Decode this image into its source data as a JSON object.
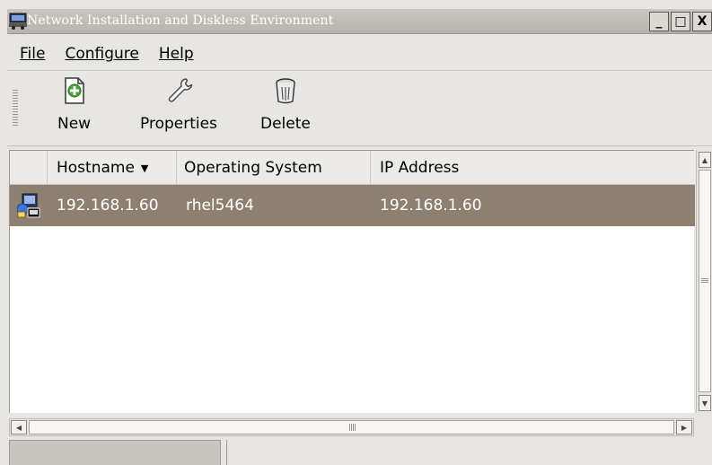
{
  "window": {
    "title": "Network Installation and Diskless Environment",
    "minimize_label": "_",
    "maximize_label": "□",
    "close_label": "X"
  },
  "menu": [
    {
      "label": "File"
    },
    {
      "label": "Configure"
    },
    {
      "label": "Help"
    }
  ],
  "toolbar": {
    "new_label": "New",
    "properties_label": "Properties",
    "delete_label": "Delete"
  },
  "table": {
    "columns": [
      "Hostname",
      "Operating System",
      "IP Address"
    ],
    "sort_indicator": "▼",
    "rows": [
      {
        "hostname": "192.168.1.60",
        "os": "rhel5464",
        "ip": "192.168.1.60"
      }
    ],
    "selected_row_color": "#8d8070"
  },
  "icons": {
    "title": "network-computers-icon",
    "new": "add-document-icon",
    "properties": "wrench-icon",
    "delete": "trash-can-icon",
    "row": "network-computer-icon"
  },
  "scrollbar_labels": {
    "h_grip": "III",
    "v_grip": "≡"
  }
}
